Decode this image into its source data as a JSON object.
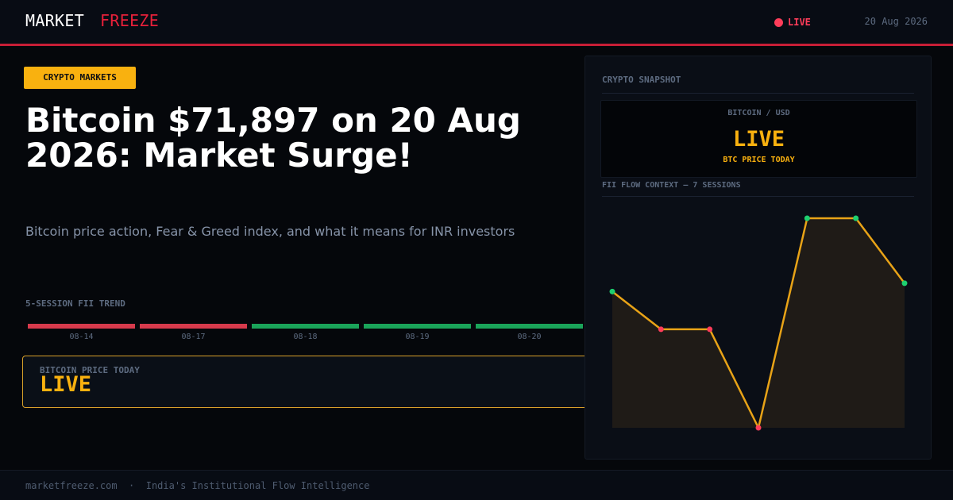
{
  "header": {
    "brand_part1": "MARKET",
    "brand_part2": "FREEZE",
    "live_label": "LIVE",
    "date": "20 Aug 2026"
  },
  "article": {
    "category": "CRYPTO MARKETS",
    "headline": "Bitcoin $71,897 on 20 Aug 2026: Market Surge!",
    "subheadline": "Bitcoin price action, Fear & Greed index, and what it means for INR investors"
  },
  "trend": {
    "title": "5-SESSION FII TREND",
    "sessions": [
      {
        "label": "08-14",
        "direction": "down"
      },
      {
        "label": "08-17",
        "direction": "down"
      },
      {
        "label": "08-18",
        "direction": "up"
      },
      {
        "label": "08-19",
        "direction": "up"
      },
      {
        "label": "08-20",
        "direction": "up"
      }
    ]
  },
  "price_box": {
    "label": "BITCOIN PRICE TODAY",
    "value": "LIVE"
  },
  "panel": {
    "title": "CRYPTO SNAPSHOT",
    "pair": "BITCOIN / USD",
    "status": "LIVE",
    "status_sub": "BTC PRICE TODAY",
    "flow_title": "FII FLOW CONTEXT — 7 SESSIONS"
  },
  "chart_data": {
    "type": "line",
    "title": "FII FLOW CONTEXT — 7 SESSIONS",
    "xlabel": "",
    "ylabel": "",
    "grid": false,
    "legend": "none",
    "x": [
      1,
      2,
      3,
      4,
      5,
      6,
      7
    ],
    "series": [
      {
        "values": [
          0.65,
          0.47,
          0.47,
          0.0,
          1.0,
          1.0,
          0.69
        ]
      }
    ],
    "point_colors": [
      "green",
      "red",
      "red",
      "red",
      "green",
      "green",
      "green"
    ],
    "ylim": [
      0,
      1
    ]
  },
  "colors": {
    "accent": "#e8203a",
    "gold": "#f9b10f",
    "up": "#1aa45a",
    "down": "#d73a4c",
    "line": "#e8a317",
    "point_up": "#1ed070",
    "point_down": "#ff3d5a"
  },
  "footer": {
    "text": "marketfreeze.com  ·  India's Institutional Flow Intelligence"
  }
}
